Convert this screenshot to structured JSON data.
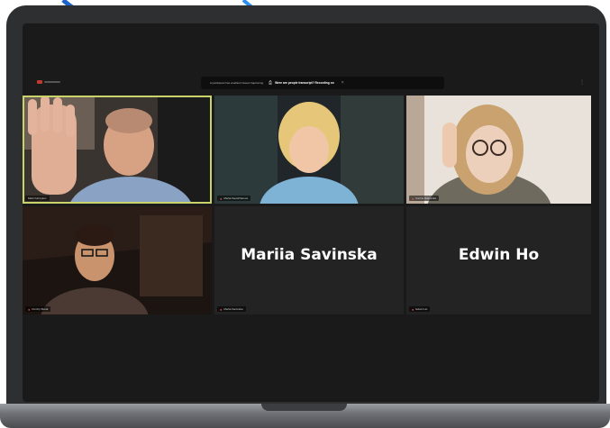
{
  "meeting": {
    "notice_text": "A participant has enabled Closed Captioning",
    "notice_link": "Were are people transcript? Recording on",
    "record_icon": "cc-icon",
    "close_icon": "close-icon"
  },
  "participants": [
    {
      "chip_label": "Mark Kalmykov",
      "muted": false,
      "video": true,
      "active": true
    },
    {
      "chip_label": "Mariia Saudzharova",
      "muted": true,
      "video": true,
      "active": false
    },
    {
      "chip_label": "Karina Rakovska",
      "muted": true,
      "video": true,
      "active": false
    },
    {
      "chip_label": "Dmitriy Burak",
      "muted": true,
      "video": true,
      "active": false
    },
    {
      "display_name": "Mariia Savinska",
      "chip_label": "Mariia Savinska",
      "muted": true,
      "video": false,
      "active": false
    },
    {
      "display_name": "Edwin Ho",
      "chip_label": "Edwin Ho",
      "muted": true,
      "video": false,
      "active": false
    }
  ],
  "colors": {
    "active_speaker_border": "#c9d36a",
    "muted_icon": "#e74c3c",
    "tile_background": "#232323",
    "ribbon": "#1e88e5"
  }
}
